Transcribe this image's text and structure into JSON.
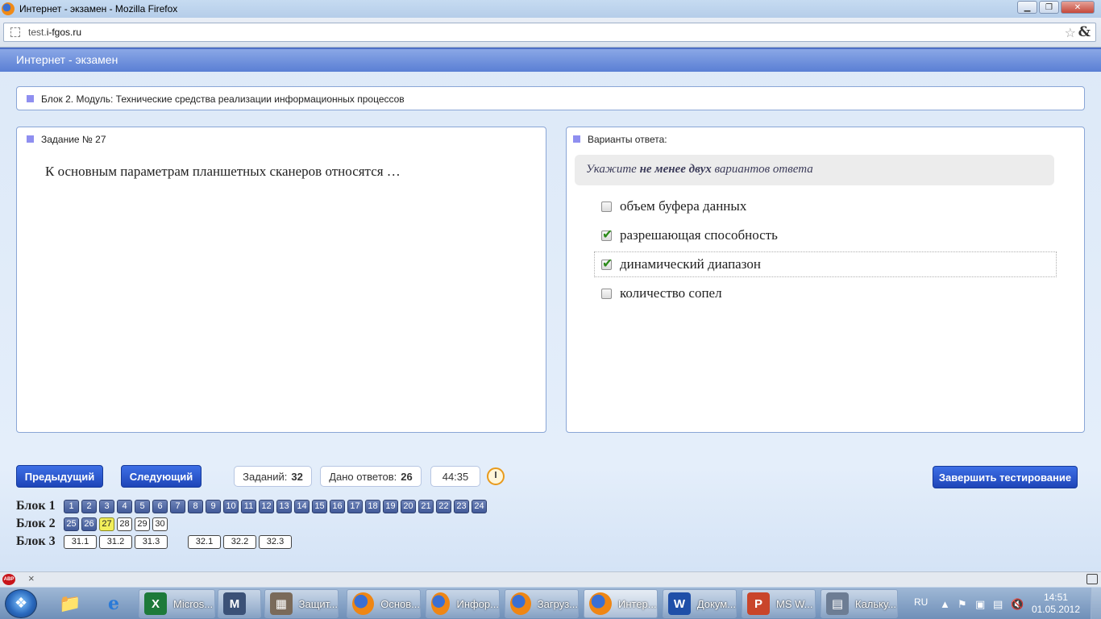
{
  "window": {
    "title": "Интернет - экзамен - Mozilla Firefox",
    "url_prefix": "test.",
    "url_domain": "i-fgos.ru",
    "amp": "&"
  },
  "page": {
    "header": "Интернет - экзамен",
    "block_title": "Блок 2. Модуль: Технические средства реализации информационных процессов",
    "task_head": "Задание № 27",
    "task_text": "К основным параметрам планшетных сканеров относятся …",
    "answers_head": "Варианты ответа:",
    "hint_pre": "Укажите ",
    "hint_bold": "не менее двух",
    "hint_post": " вариантов ответа",
    "options": [
      {
        "label": "объем буфера данных",
        "checked": false
      },
      {
        "label": "разрешающая способность",
        "checked": true
      },
      {
        "label": "динамический диапазон",
        "checked": true
      },
      {
        "label": "количество сопел",
        "checked": false
      }
    ]
  },
  "controls": {
    "prev": "Предыдущий",
    "next": "Следующий",
    "tasks_label": "Заданий:",
    "tasks_value": "32",
    "answered_label": "Дано ответов:",
    "answered_value": "26",
    "timer": "44:35",
    "finish": "Завершить тестирование"
  },
  "grid": {
    "block1_label": "Блок 1",
    "block2_label": "Блок 2",
    "block3_label": "Блок 3",
    "block1": [
      "1",
      "2",
      "3",
      "4",
      "5",
      "6",
      "7",
      "8",
      "9",
      "10",
      "11",
      "12",
      "13",
      "14",
      "15",
      "16",
      "17",
      "18",
      "19",
      "20",
      "21",
      "22",
      "23",
      "24"
    ],
    "block2": [
      {
        "n": "25",
        "s": "done"
      },
      {
        "n": "26",
        "s": "done"
      },
      {
        "n": "27",
        "s": "cur"
      },
      {
        "n": "28",
        "s": "empty"
      },
      {
        "n": "29",
        "s": "empty"
      },
      {
        "n": "30",
        "s": "empty"
      }
    ],
    "block3": [
      "31.1",
      "31.2",
      "31.3",
      "32.1",
      "32.2",
      "32.3"
    ]
  },
  "addon": {
    "abp": "ABP",
    "close": "×"
  },
  "taskbar": {
    "items": [
      {
        "label": "Micros...",
        "icon": "excel-icon",
        "color": "#1d7a3a",
        "glyph": "X"
      },
      {
        "label": "",
        "icon": "m-app-icon",
        "color": "#3b5177",
        "glyph": "M"
      },
      {
        "label": "Защит...",
        "icon": "firewall-icon",
        "color": "#7a6a5a",
        "glyph": "▦"
      },
      {
        "label": "Основ...",
        "icon": "firefox-icon",
        "color": "",
        "glyph": ""
      },
      {
        "label": "Инфор...",
        "icon": "firefox-icon",
        "color": "",
        "glyph": ""
      },
      {
        "label": "Загруз...",
        "icon": "firefox-icon",
        "color": "",
        "glyph": ""
      },
      {
        "label": "Интер...",
        "icon": "firefox-icon",
        "color": "",
        "glyph": ""
      },
      {
        "label": "Докум...",
        "icon": "word-icon",
        "color": "#1f4fa8",
        "glyph": "W"
      },
      {
        "label": "MS W...",
        "icon": "powerpoint-icon",
        "color": "#c9452a",
        "glyph": "P"
      },
      {
        "label": "Кальку...",
        "icon": "calculator-icon",
        "color": "#6d7d94",
        "glyph": "▤"
      }
    ],
    "lang": "RU",
    "time": "14:51",
    "date": "01.05.2012"
  }
}
